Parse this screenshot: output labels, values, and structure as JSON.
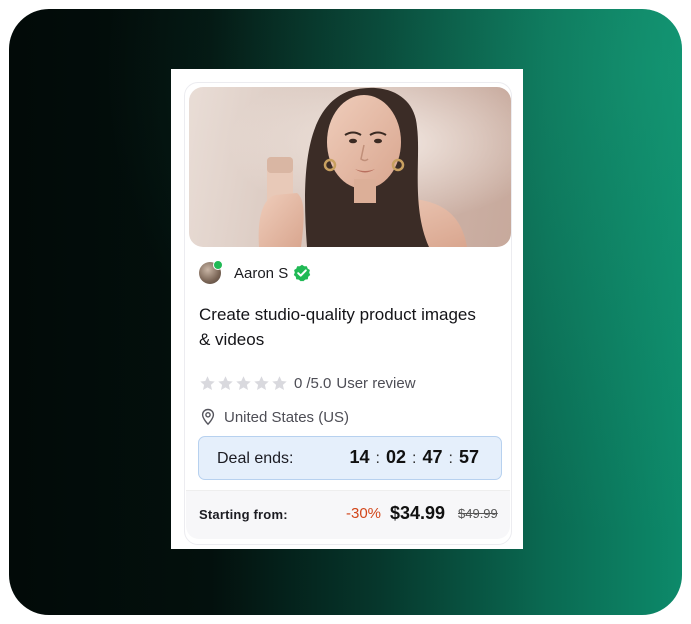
{
  "seller": {
    "name": "Aaron S",
    "verified": true,
    "online": true
  },
  "listing": {
    "title": "Create studio-quality product images & videos"
  },
  "rating": {
    "value": "0",
    "scale": "/5.0",
    "label": "User review",
    "stars": 5,
    "filled_stars": 0
  },
  "location": {
    "text": "United States (US)"
  },
  "deal": {
    "label": "Deal ends:",
    "hours": "14",
    "minutes": "02",
    "seconds": "47",
    "frames": "57",
    "separator": ":"
  },
  "pricing": {
    "starting_label": "Starting from:",
    "discount": "-30%",
    "price": "$34.99",
    "original_price": "$49.99"
  },
  "colors": {
    "discount": "#d2461a",
    "deal_bg": "#e5effb",
    "verified": "#20b955"
  }
}
